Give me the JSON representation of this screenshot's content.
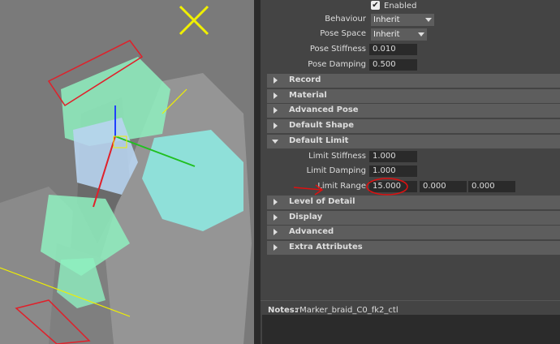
{
  "viewport": {
    "colors": {
      "bg": "#7a7a7a",
      "mesh": "#8f8f8f",
      "green": "#8ff0c0",
      "cyan": "#8ee8e0",
      "red": "#e0202a",
      "yellow": "#f0f000",
      "blue": "#2040ff"
    }
  },
  "top": {
    "enabled_label": "Enabled",
    "enabled_checked": true
  },
  "fields": [
    {
      "label": "Behaviour",
      "value": "Inherit",
      "kind": "dropdown"
    },
    {
      "label": "Pose Space",
      "value": "Inherit",
      "kind": "dropdown"
    },
    {
      "label": "Pose Stiffness",
      "value": "0.010",
      "kind": "number"
    },
    {
      "label": "Pose Damping",
      "value": "0.500",
      "kind": "number"
    }
  ],
  "sections_before": [
    {
      "label": "Record"
    },
    {
      "label": "Material"
    },
    {
      "label": "Advanced Pose"
    },
    {
      "label": "Default Shape"
    }
  ],
  "open_section": {
    "label": "Default Limit"
  },
  "limit_fields": [
    {
      "label": "Limit Stiffness",
      "value": "1.000"
    },
    {
      "label": "Limit Damping",
      "value": "1.000"
    }
  ],
  "limit_range": {
    "label": "Limit Range",
    "values": [
      "15.000",
      "0.000",
      "0.000"
    ]
  },
  "sections_after": [
    {
      "label": "Level of Detail"
    },
    {
      "label": "Display"
    },
    {
      "label": "Advanced"
    },
    {
      "label": "Extra Attributes"
    }
  ],
  "notes": {
    "label": "Notes:",
    "value": "rMarker_braid_C0_fk2_ctl"
  },
  "annotation_color": "#e01010"
}
